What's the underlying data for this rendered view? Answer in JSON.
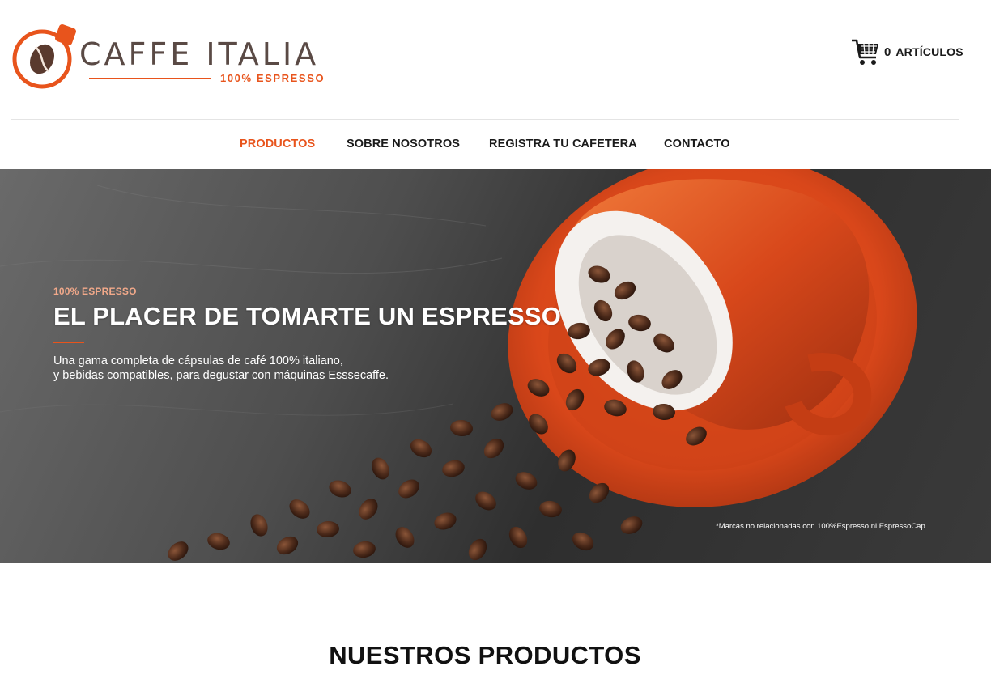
{
  "logo": {
    "title": "CAFFE ITALIA",
    "subtitle": "100% ESPRESSO"
  },
  "cart": {
    "count": "0",
    "label": "ARTÍCULOS",
    "icon": "cart-icon"
  },
  "nav": {
    "items": [
      {
        "label": "PRODUCTOS",
        "active": true
      },
      {
        "label": "SOBRE NOSOTROS",
        "active": false
      },
      {
        "label": "REGISTRA TU CAFETERA",
        "active": false
      },
      {
        "label": "CONTACTO",
        "active": false
      }
    ]
  },
  "hero": {
    "kicker": "100% ESPRESSO",
    "title": "EL PLACER DE TOMARTE UN ESPRESSO",
    "description_line1": "Una gama completa de cápsulas de café 100% italiano,",
    "description_line2": "y bebidas compatibles, para degustar con máquinas Esssecaffe.",
    "note": "*Marcas no relacionadas con 100%Espresso ni EspressoCap."
  },
  "section": {
    "title": "NUESTROS PRODUCTOS"
  },
  "colors": {
    "accent": "#e8541c",
    "text": "#1a1a1a",
    "logo_text": "#5a4a45"
  }
}
